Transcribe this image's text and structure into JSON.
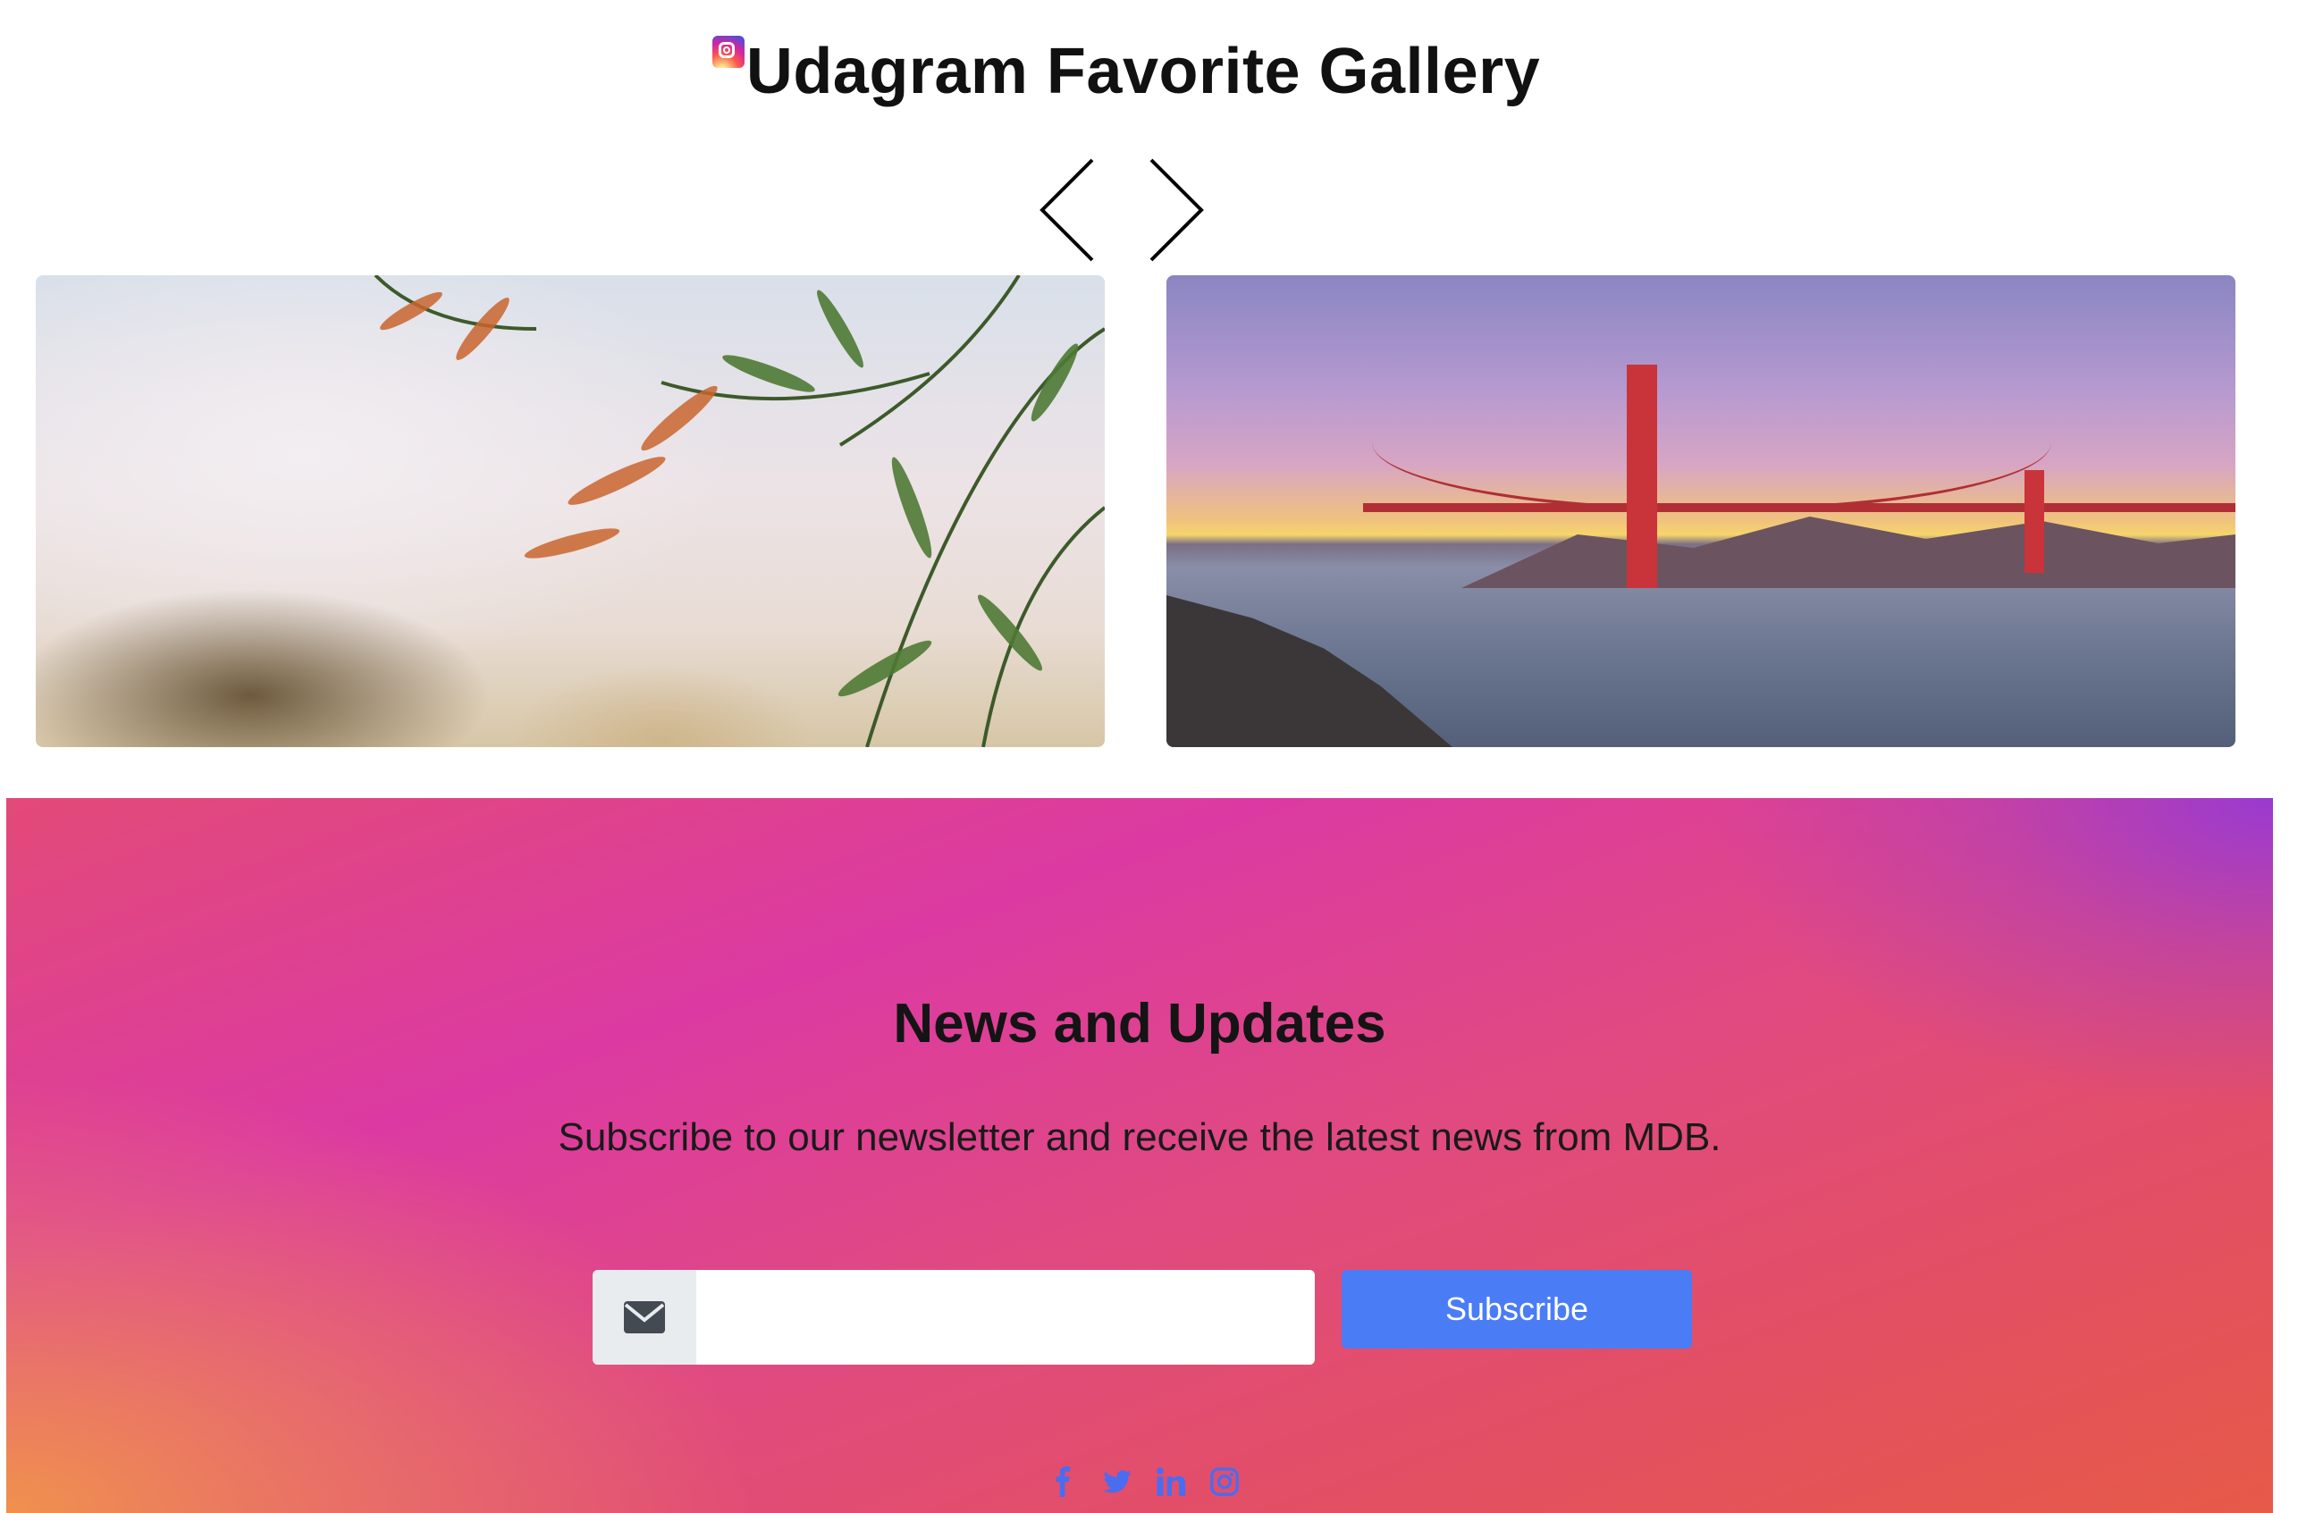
{
  "header": {
    "title": "Udagram Favorite Gallery",
    "logo_icon": "instagram-icon"
  },
  "carousel": {
    "prev_icon": "chevron-left-icon",
    "next_icon": "chevron-right-icon",
    "slides": [
      {
        "subject": "blurred-foliage-photo"
      },
      {
        "subject": "golden-gate-bridge-photo"
      }
    ]
  },
  "newsletter": {
    "title": "News and Updates",
    "subtitle": "Subscribe to our newsletter and receive the latest news from MDB.",
    "email_icon": "envelope-icon",
    "email_value": "",
    "email_placeholder": "",
    "subscribe_label": "Subscribe",
    "social_icons": [
      "facebook-icon",
      "twitter-icon",
      "linkedin-icon",
      "instagram-icon"
    ]
  },
  "colors": {
    "primary_button": "#4a7cf6",
    "social_icon": "#4a6cf0",
    "gradient": [
      "#f0914e",
      "#e24a78",
      "#dc3aa2",
      "#9a3ad0"
    ]
  }
}
